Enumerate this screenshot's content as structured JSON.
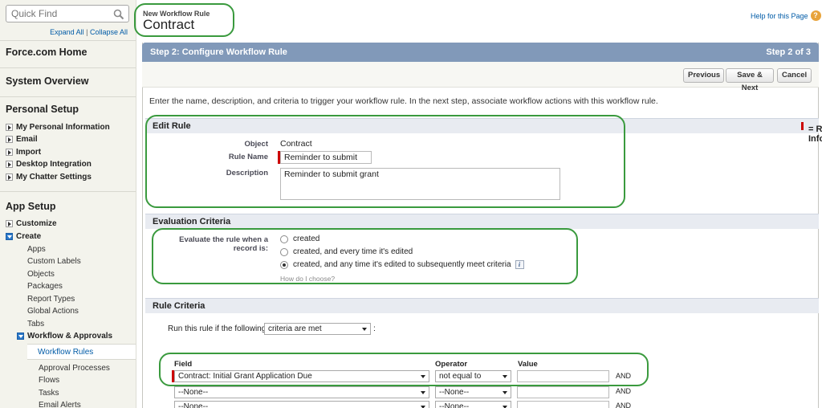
{
  "sidebar": {
    "quick_find_placeholder": "Quick Find",
    "expand_all": "Expand All",
    "separator": "|",
    "collapse_all": "Collapse All",
    "force_home": "Force.com Home",
    "system_overview": "System Overview",
    "personal_setup": "Personal Setup",
    "personal_items": [
      "My Personal Information",
      "Email",
      "Import",
      "Desktop Integration",
      "My Chatter Settings"
    ],
    "app_setup": "App Setup",
    "customize": "Customize",
    "create": "Create",
    "create_items": [
      "Apps",
      "Custom Labels",
      "Objects",
      "Packages",
      "Report Types",
      "Global Actions",
      "Tabs"
    ],
    "workflow_approvals": "Workflow & Approvals",
    "workflow_items": [
      "Workflow Rules",
      "Approval Processes",
      "Flows",
      "Tasks",
      "Email Alerts"
    ]
  },
  "header": {
    "subtitle": "New Workflow Rule",
    "title": "Contract",
    "help_link": "Help for this Page",
    "help_icon": "?"
  },
  "step": {
    "title": "Step 2: Configure Workflow Rule",
    "counter": "Step 2 of 3"
  },
  "buttons": {
    "previous": "Previous",
    "save_next": "Save & Next",
    "cancel": "Cancel"
  },
  "intro": "Enter the name, description, and criteria to trigger your workflow rule. In the next step, associate workflow actions with this workflow rule.",
  "edit_rule": {
    "heading": "Edit Rule",
    "required_note": "= Required Information",
    "object_label": "Object",
    "object_value": "Contract",
    "rule_name_label": "Rule Name",
    "rule_name_value": "Reminder to submit",
    "description_label": "Description",
    "description_value": "Reminder to submit grant"
  },
  "evaluation": {
    "heading": "Evaluation Criteria",
    "label": "Evaluate the rule when a record is:",
    "options": [
      "created",
      "created, and every time it's edited",
      "created, and any time it's edited to subsequently meet criteria"
    ],
    "selected_index": 2,
    "info_icon": "i",
    "how_link": "How do I choose?"
  },
  "criteria": {
    "heading": "Rule Criteria",
    "run_label": "Run this rule if the following",
    "run_value": "criteria are met",
    "colon": ":",
    "col_field": "Field",
    "col_operator": "Operator",
    "col_value": "Value",
    "rows": [
      {
        "field": "Contract: Initial Grant Application Due",
        "operator": "not equal to",
        "value": "",
        "join": "AND"
      },
      {
        "field": "--None--",
        "operator": "--None--",
        "value": "",
        "join": "AND"
      },
      {
        "field": "--None--",
        "operator": "--None--",
        "value": "",
        "join": "AND"
      }
    ]
  },
  "colors": {
    "step_bar": "#8199b9",
    "link": "#015ba7",
    "required": "#cc0000",
    "callout": "#3a9a3e"
  }
}
